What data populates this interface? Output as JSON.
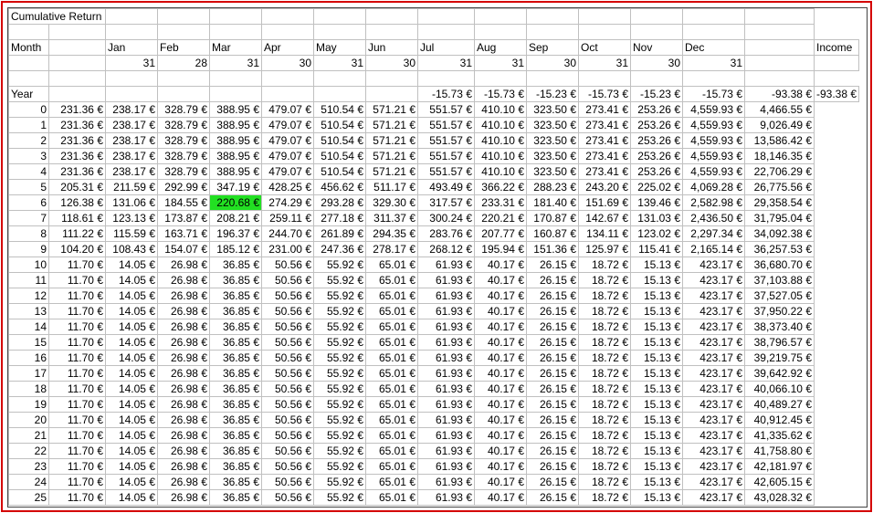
{
  "title": "Cumulative Return",
  "header": {
    "month_label": "Month",
    "months": [
      "Jan",
      "Feb",
      "Mar",
      "Apr",
      "May",
      "Jun",
      "Jul",
      "Aug",
      "Sep",
      "Oct",
      "Nov",
      "Dec"
    ],
    "income_label": "Income",
    "days": [
      "31",
      "28",
      "31",
      "30",
      "31",
      "30",
      "31",
      "31",
      "30",
      "31",
      "30",
      "31"
    ]
  },
  "year_row": {
    "label": "Year",
    "values": [
      "",
      "",
      "",
      "",
      "",
      "",
      "-15.73 €",
      "-15.73 €",
      "-15.23 €",
      "-15.73 €",
      "-15.23 €",
      "-15.73 €"
    ],
    "total": "-93.38 €",
    "income": "-93.38 €"
  },
  "highlight_color": "#22e022",
  "rows": [
    {
      "year": "0",
      "values": [
        "231.36 €",
        "238.17 €",
        "328.79 €",
        "388.95 €",
        "479.07 €",
        "510.54 €",
        "571.21 €",
        "551.57 €",
        "410.10 €",
        "323.50 €",
        "273.41 €",
        "253.26 €"
      ],
      "total": "4,559.93 €",
      "income": "4,466.55 €"
    },
    {
      "year": "1",
      "values": [
        "231.36 €",
        "238.17 €",
        "328.79 €",
        "388.95 €",
        "479.07 €",
        "510.54 €",
        "571.21 €",
        "551.57 €",
        "410.10 €",
        "323.50 €",
        "273.41 €",
        "253.26 €"
      ],
      "total": "4,559.93 €",
      "income": "9,026.49 €"
    },
    {
      "year": "2",
      "values": [
        "231.36 €",
        "238.17 €",
        "328.79 €",
        "388.95 €",
        "479.07 €",
        "510.54 €",
        "571.21 €",
        "551.57 €",
        "410.10 €",
        "323.50 €",
        "273.41 €",
        "253.26 €"
      ],
      "total": "4,559.93 €",
      "income": "13,586.42 €"
    },
    {
      "year": "3",
      "values": [
        "231.36 €",
        "238.17 €",
        "328.79 €",
        "388.95 €",
        "479.07 €",
        "510.54 €",
        "571.21 €",
        "551.57 €",
        "410.10 €",
        "323.50 €",
        "273.41 €",
        "253.26 €"
      ],
      "total": "4,559.93 €",
      "income": "18,146.35 €"
    },
    {
      "year": "4",
      "values": [
        "231.36 €",
        "238.17 €",
        "328.79 €",
        "388.95 €",
        "479.07 €",
        "510.54 €",
        "571.21 €",
        "551.57 €",
        "410.10 €",
        "323.50 €",
        "273.41 €",
        "253.26 €"
      ],
      "total": "4,559.93 €",
      "income": "22,706.29 €"
    },
    {
      "year": "5",
      "values": [
        "205.31 €",
        "211.59 €",
        "292.99 €",
        "347.19 €",
        "428.25 €",
        "456.62 €",
        "511.17 €",
        "493.49 €",
        "366.22 €",
        "288.23 €",
        "243.20 €",
        "225.02 €"
      ],
      "total": "4,069.28 €",
      "income": "26,775.56 €"
    },
    {
      "year": "6",
      "values": [
        "126.38 €",
        "131.06 €",
        "184.55 €",
        "220.68 €",
        "274.29 €",
        "293.28 €",
        "329.30 €",
        "317.57 €",
        "233.31 €",
        "181.40 €",
        "151.69 €",
        "139.46 €"
      ],
      "total": "2,582.98 €",
      "income": "29,358.54 €",
      "highlight": 3
    },
    {
      "year": "7",
      "values": [
        "118.61 €",
        "123.13 €",
        "173.87 €",
        "208.21 €",
        "259.11 €",
        "277.18 €",
        "311.37 €",
        "300.24 €",
        "220.21 €",
        "170.87 €",
        "142.67 €",
        "131.03 €"
      ],
      "total": "2,436.50 €",
      "income": "31,795.04 €"
    },
    {
      "year": "8",
      "values": [
        "111.22 €",
        "115.59 €",
        "163.71 €",
        "196.37 €",
        "244.70 €",
        "261.89 €",
        "294.35 €",
        "283.76 €",
        "207.77 €",
        "160.87 €",
        "134.11 €",
        "123.02 €"
      ],
      "total": "2,297.34 €",
      "income": "34,092.38 €"
    },
    {
      "year": "9",
      "values": [
        "104.20 €",
        "108.43 €",
        "154.07 €",
        "185.12 €",
        "231.00 €",
        "247.36 €",
        "278.17 €",
        "268.12 €",
        "195.94 €",
        "151.36 €",
        "125.97 €",
        "115.41 €"
      ],
      "total": "2,165.14 €",
      "income": "36,257.53 €"
    },
    {
      "year": "10",
      "values": [
        "11.70 €",
        "14.05 €",
        "26.98 €",
        "36.85 €",
        "50.56 €",
        "55.92 €",
        "65.01 €",
        "61.93 €",
        "40.17 €",
        "26.15 €",
        "18.72 €",
        "15.13 €"
      ],
      "total": "423.17 €",
      "income": "36,680.70 €"
    },
    {
      "year": "11",
      "values": [
        "11.70 €",
        "14.05 €",
        "26.98 €",
        "36.85 €",
        "50.56 €",
        "55.92 €",
        "65.01 €",
        "61.93 €",
        "40.17 €",
        "26.15 €",
        "18.72 €",
        "15.13 €"
      ],
      "total": "423.17 €",
      "income": "37,103.88 €"
    },
    {
      "year": "12",
      "values": [
        "11.70 €",
        "14.05 €",
        "26.98 €",
        "36.85 €",
        "50.56 €",
        "55.92 €",
        "65.01 €",
        "61.93 €",
        "40.17 €",
        "26.15 €",
        "18.72 €",
        "15.13 €"
      ],
      "total": "423.17 €",
      "income": "37,527.05 €"
    },
    {
      "year": "13",
      "values": [
        "11.70 €",
        "14.05 €",
        "26.98 €",
        "36.85 €",
        "50.56 €",
        "55.92 €",
        "65.01 €",
        "61.93 €",
        "40.17 €",
        "26.15 €",
        "18.72 €",
        "15.13 €"
      ],
      "total": "423.17 €",
      "income": "37,950.22 €"
    },
    {
      "year": "14",
      "values": [
        "11.70 €",
        "14.05 €",
        "26.98 €",
        "36.85 €",
        "50.56 €",
        "55.92 €",
        "65.01 €",
        "61.93 €",
        "40.17 €",
        "26.15 €",
        "18.72 €",
        "15.13 €"
      ],
      "total": "423.17 €",
      "income": "38,373.40 €"
    },
    {
      "year": "15",
      "values": [
        "11.70 €",
        "14.05 €",
        "26.98 €",
        "36.85 €",
        "50.56 €",
        "55.92 €",
        "65.01 €",
        "61.93 €",
        "40.17 €",
        "26.15 €",
        "18.72 €",
        "15.13 €"
      ],
      "total": "423.17 €",
      "income": "38,796.57 €"
    },
    {
      "year": "16",
      "values": [
        "11.70 €",
        "14.05 €",
        "26.98 €",
        "36.85 €",
        "50.56 €",
        "55.92 €",
        "65.01 €",
        "61.93 €",
        "40.17 €",
        "26.15 €",
        "18.72 €",
        "15.13 €"
      ],
      "total": "423.17 €",
      "income": "39,219.75 €"
    },
    {
      "year": "17",
      "values": [
        "11.70 €",
        "14.05 €",
        "26.98 €",
        "36.85 €",
        "50.56 €",
        "55.92 €",
        "65.01 €",
        "61.93 €",
        "40.17 €",
        "26.15 €",
        "18.72 €",
        "15.13 €"
      ],
      "total": "423.17 €",
      "income": "39,642.92 €"
    },
    {
      "year": "18",
      "values": [
        "11.70 €",
        "14.05 €",
        "26.98 €",
        "36.85 €",
        "50.56 €",
        "55.92 €",
        "65.01 €",
        "61.93 €",
        "40.17 €",
        "26.15 €",
        "18.72 €",
        "15.13 €"
      ],
      "total": "423.17 €",
      "income": "40,066.10 €"
    },
    {
      "year": "19",
      "values": [
        "11.70 €",
        "14.05 €",
        "26.98 €",
        "36.85 €",
        "50.56 €",
        "55.92 €",
        "65.01 €",
        "61.93 €",
        "40.17 €",
        "26.15 €",
        "18.72 €",
        "15.13 €"
      ],
      "total": "423.17 €",
      "income": "40,489.27 €"
    },
    {
      "year": "20",
      "values": [
        "11.70 €",
        "14.05 €",
        "26.98 €",
        "36.85 €",
        "50.56 €",
        "55.92 €",
        "65.01 €",
        "61.93 €",
        "40.17 €",
        "26.15 €",
        "18.72 €",
        "15.13 €"
      ],
      "total": "423.17 €",
      "income": "40,912.45 €"
    },
    {
      "year": "21",
      "values": [
        "11.70 €",
        "14.05 €",
        "26.98 €",
        "36.85 €",
        "50.56 €",
        "55.92 €",
        "65.01 €",
        "61.93 €",
        "40.17 €",
        "26.15 €",
        "18.72 €",
        "15.13 €"
      ],
      "total": "423.17 €",
      "income": "41,335.62 €"
    },
    {
      "year": "22",
      "values": [
        "11.70 €",
        "14.05 €",
        "26.98 €",
        "36.85 €",
        "50.56 €",
        "55.92 €",
        "65.01 €",
        "61.93 €",
        "40.17 €",
        "26.15 €",
        "18.72 €",
        "15.13 €"
      ],
      "total": "423.17 €",
      "income": "41,758.80 €"
    },
    {
      "year": "23",
      "values": [
        "11.70 €",
        "14.05 €",
        "26.98 €",
        "36.85 €",
        "50.56 €",
        "55.92 €",
        "65.01 €",
        "61.93 €",
        "40.17 €",
        "26.15 €",
        "18.72 €",
        "15.13 €"
      ],
      "total": "423.17 €",
      "income": "42,181.97 €"
    },
    {
      "year": "24",
      "values": [
        "11.70 €",
        "14.05 €",
        "26.98 €",
        "36.85 €",
        "50.56 €",
        "55.92 €",
        "65.01 €",
        "61.93 €",
        "40.17 €",
        "26.15 €",
        "18.72 €",
        "15.13 €"
      ],
      "total": "423.17 €",
      "income": "42,605.15 €"
    },
    {
      "year": "25",
      "values": [
        "11.70 €",
        "14.05 €",
        "26.98 €",
        "36.85 €",
        "50.56 €",
        "55.92 €",
        "65.01 €",
        "61.93 €",
        "40.17 €",
        "26.15 €",
        "18.72 €",
        "15.13 €"
      ],
      "total": "423.17 €",
      "income": "43,028.32 €"
    }
  ]
}
